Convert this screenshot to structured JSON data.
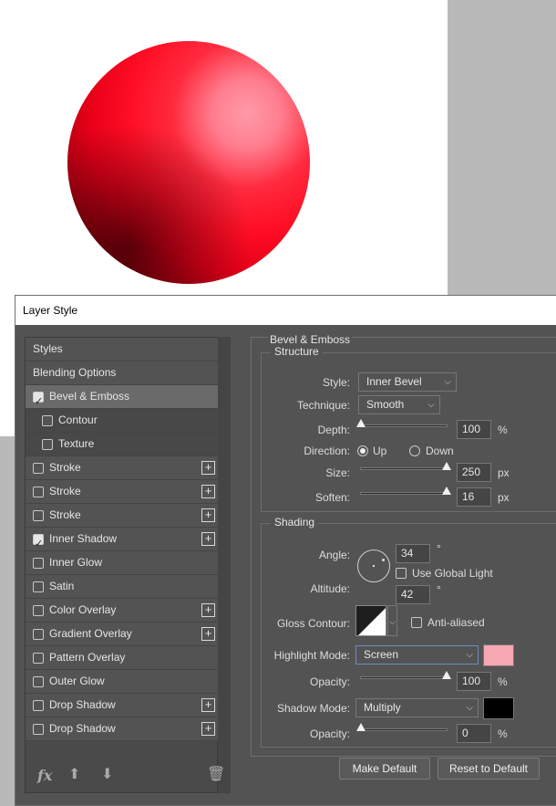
{
  "canvas": {
    "sphere_color": "#ff1a30"
  },
  "dialog": {
    "title": "Layer Style"
  },
  "styles_list": [
    {
      "label": "Styles",
      "type": "header"
    },
    {
      "label": "Blending Options",
      "type": "header"
    },
    {
      "label": "Bevel & Emboss",
      "checked": true,
      "selected": true,
      "plus": false
    },
    {
      "label": "Contour",
      "checked": false,
      "sub": true,
      "plus": false
    },
    {
      "label": "Texture",
      "checked": false,
      "sub": true,
      "plus": false
    },
    {
      "label": "Stroke",
      "checked": false,
      "plus": true
    },
    {
      "label": "Stroke",
      "checked": false,
      "plus": true
    },
    {
      "label": "Stroke",
      "checked": false,
      "plus": true
    },
    {
      "label": "Inner Shadow",
      "checked": true,
      "plus": true
    },
    {
      "label": "Inner Glow",
      "checked": false,
      "plus": false
    },
    {
      "label": "Satin",
      "checked": false,
      "plus": false
    },
    {
      "label": "Color Overlay",
      "checked": false,
      "plus": true
    },
    {
      "label": "Gradient Overlay",
      "checked": false,
      "plus": true
    },
    {
      "label": "Pattern Overlay",
      "checked": false,
      "plus": false
    },
    {
      "label": "Outer Glow",
      "checked": false,
      "plus": false
    },
    {
      "label": "Drop Shadow",
      "checked": false,
      "plus": true
    },
    {
      "label": "Drop Shadow",
      "checked": false,
      "plus": true
    }
  ],
  "bevel": {
    "title": "Bevel & Emboss",
    "structure_title": "Structure",
    "style_label": "Style:",
    "style_value": "Inner Bevel",
    "technique_label": "Technique:",
    "technique_value": "Smooth",
    "depth_label": "Depth:",
    "depth_value": "100",
    "depth_level": 0.0,
    "direction_label": "Direction:",
    "dir_up": "Up",
    "dir_down": "Down",
    "direction_selected": "Up",
    "size_label": "Size:",
    "size_value": "250",
    "size_level": 1.0,
    "soften_label": "Soften:",
    "soften_value": "16",
    "soften_level": 1.0,
    "pct": "%",
    "px": "px"
  },
  "shading": {
    "title": "Shading",
    "angle_label": "Angle:",
    "angle_value": "34",
    "degree": "°",
    "global_light_label": "Use Global Light",
    "global_light": false,
    "altitude_label": "Altitude:",
    "altitude_value": "42",
    "gloss_label": "Gloss Contour:",
    "antialias_label": "Anti-aliased",
    "antialias": false,
    "highlight_label": "Highlight Mode:",
    "highlight_value": "Screen",
    "highlight_color": "#f7a6b4",
    "opacity_label": "Opacity:",
    "opacity_value": "100",
    "opacity_level": 1.0,
    "shadow_label": "Shadow Mode:",
    "shadow_value": "Multiply",
    "shadow_color": "#000000",
    "opacity2_label": "Opacity:",
    "opacity2_value": "0",
    "opacity2_level": 0.0
  },
  "buttons": {
    "make_default": "Make Default",
    "reset_default": "Reset to Default"
  },
  "icons": [
    "fx-icon",
    "move-up-icon",
    "move-down-icon",
    "trash-icon"
  ]
}
